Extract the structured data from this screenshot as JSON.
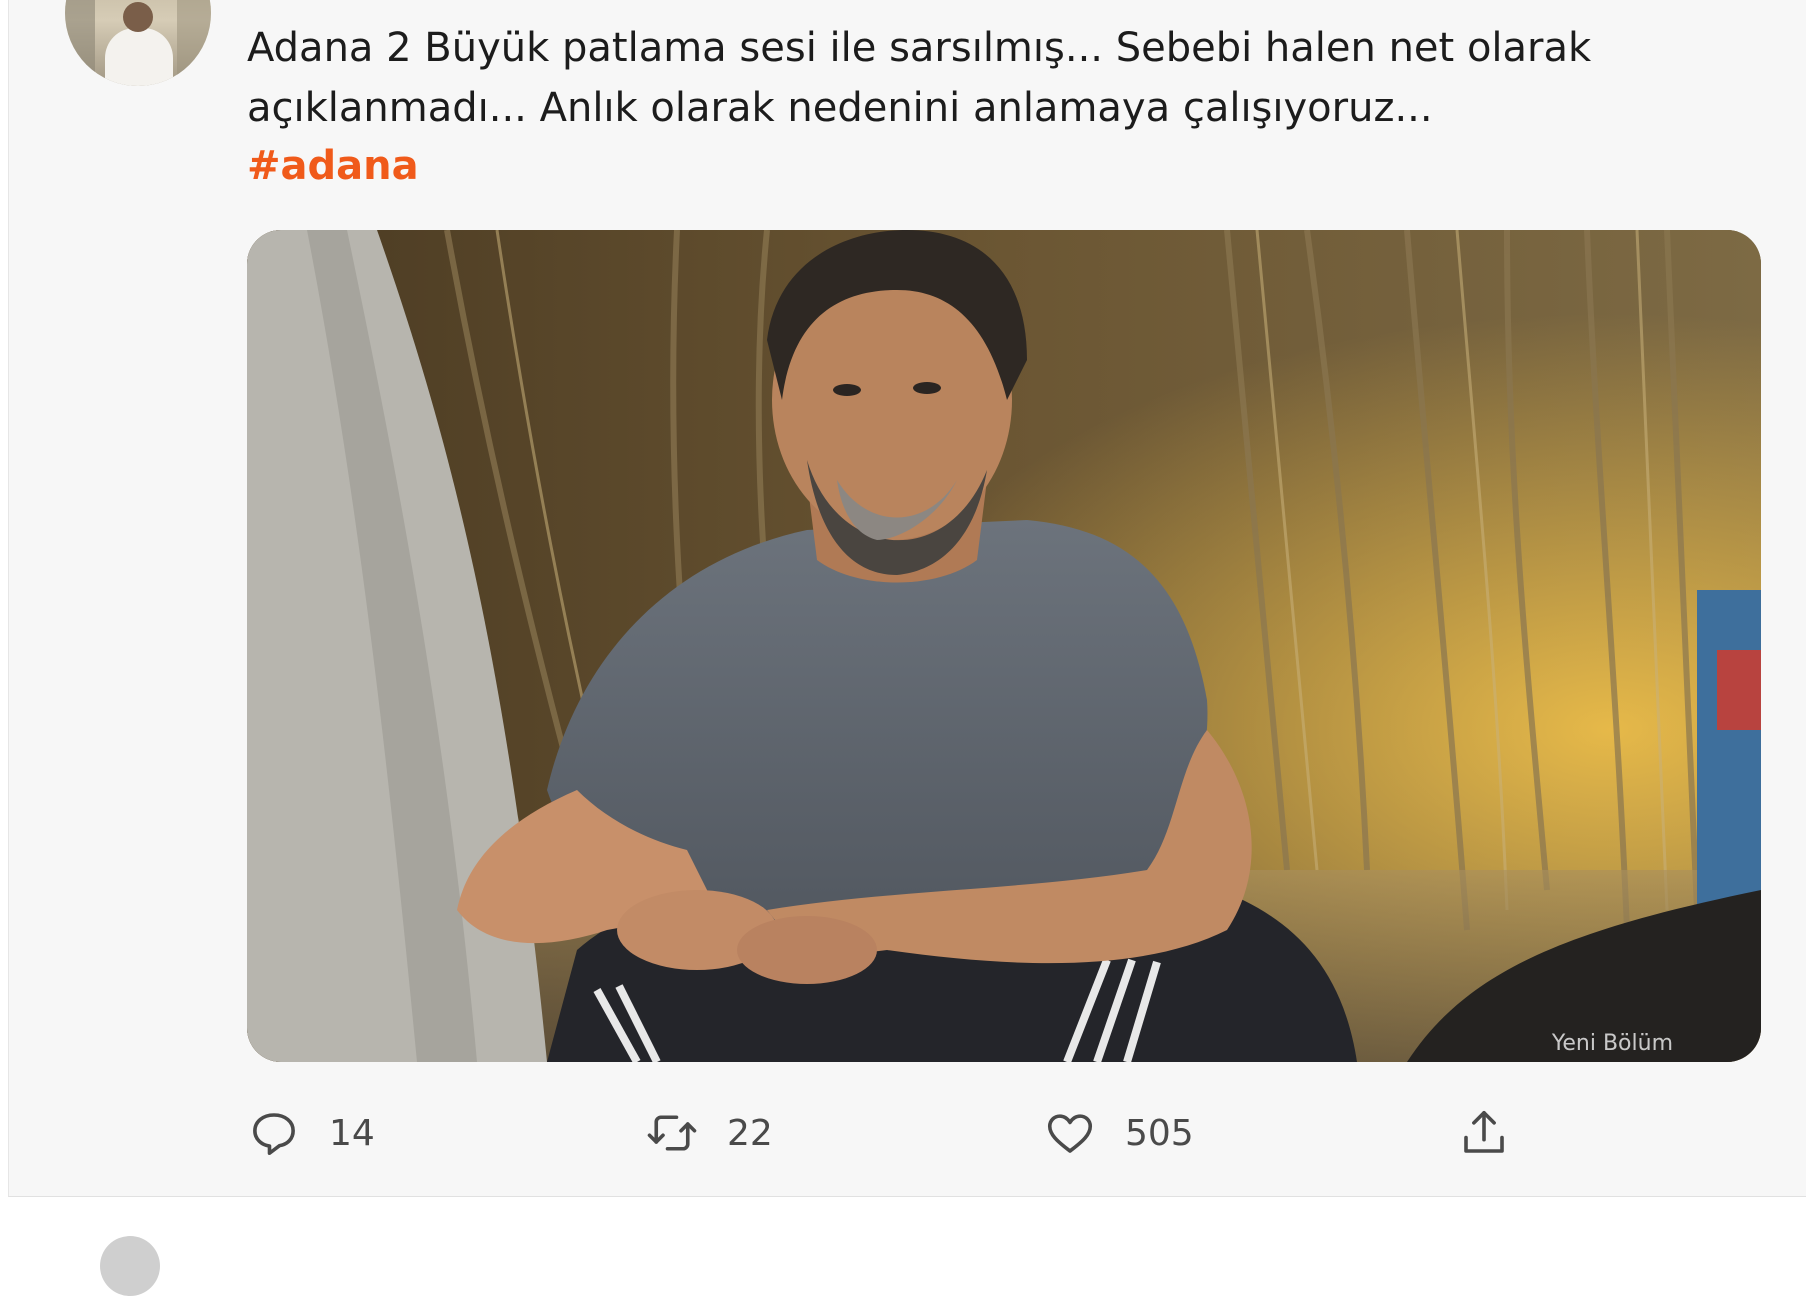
{
  "tweet": {
    "text": "Adana 2 Büyük patlama sesi ile sarsılmış... Sebebi halen net olarak açıklanmadı... Anlık olarak nedenini anlamaya çalışıyoruz...",
    "hashtag": "#adana",
    "media_caption": "Yeni Bölüm"
  },
  "actions": {
    "reply_count": "14",
    "retweet_count": "22",
    "like_count": "505"
  },
  "colors": {
    "hashtag": "#f05a1a",
    "background": "#f7f7f7",
    "icon": "#4a4a4a"
  },
  "icons": [
    "reply-icon",
    "retweet-icon",
    "like-icon",
    "share-icon"
  ]
}
